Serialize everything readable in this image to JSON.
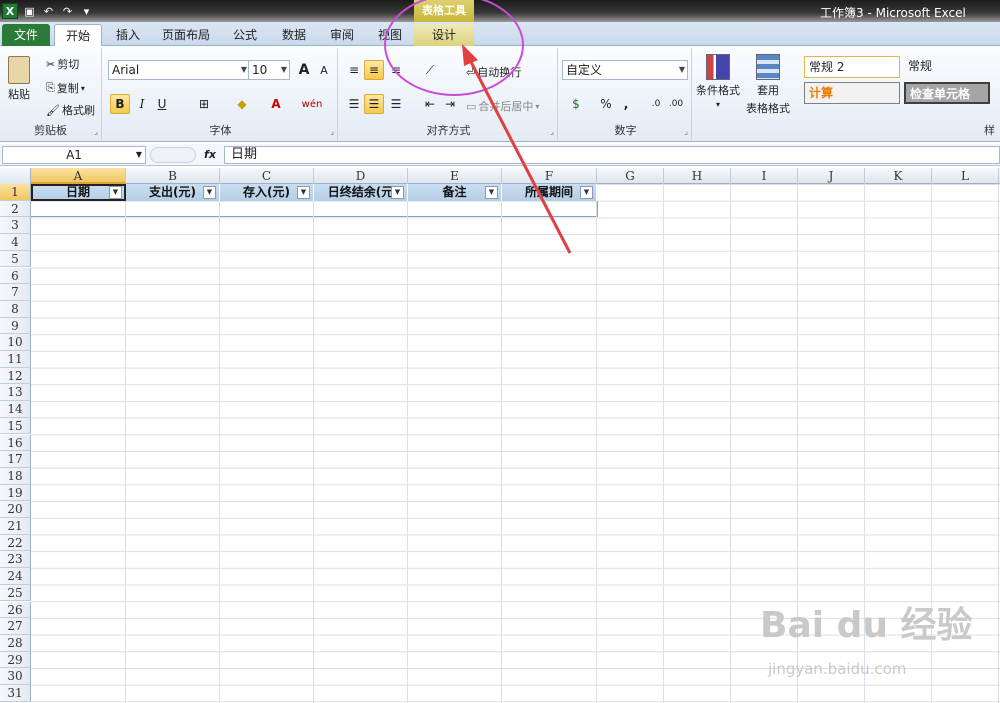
{
  "window": {
    "title": "工作簿3 - Microsoft Excel",
    "context_label": "表格工具"
  },
  "qat": {
    "logo": "X",
    "icons": [
      "save-icon",
      "undo-icon",
      "redo-icon",
      "customize-icon"
    ]
  },
  "tabs": [
    "文件",
    "开始",
    "插入",
    "页面布局",
    "公式",
    "数据",
    "审阅",
    "视图",
    "设计"
  ],
  "ribbon": {
    "clipboard": {
      "paste": "粘贴",
      "cut": "剪切",
      "copy": "复制",
      "format_painter": "格式刷",
      "label": "剪贴板"
    },
    "font": {
      "name": "Arial",
      "size": "10",
      "grow": "A",
      "shrink": "A",
      "bold": "B",
      "italic": "I",
      "underline": "U",
      "phonetic": "wén",
      "label": "字体"
    },
    "align": {
      "wrap": "自动换行",
      "merge": "合并后居中",
      "label": "对齐方式"
    },
    "number": {
      "format": "自定义",
      "percent": "%",
      "comma": ",",
      "label": "数字"
    },
    "styles": {
      "conditional": "条件格式",
      "table_format_1": "套用",
      "table_format_2": "表格格式",
      "style_normal2": "常规 2",
      "style_normal": "常规",
      "style_calc": "计算",
      "style_check": "检查单元格",
      "label_partial": "样"
    }
  },
  "formula_bar": {
    "name_box": "A1",
    "fx": "fx",
    "value": "日期"
  },
  "columns": [
    "A",
    "B",
    "C",
    "D",
    "E",
    "F",
    "G",
    "H",
    "I",
    "J",
    "K",
    "L"
  ],
  "rows": [
    "1",
    "2",
    "3",
    "4",
    "5",
    "6",
    "7",
    "8",
    "9",
    "10",
    "11",
    "12",
    "13",
    "14",
    "15",
    "16",
    "17",
    "18",
    "19",
    "20",
    "21",
    "22",
    "23",
    "24",
    "25",
    "26",
    "27",
    "28",
    "29",
    "30",
    "31"
  ],
  "table_headers": [
    "日期",
    "支出(元)",
    "存入(元)",
    "日终结余(元",
    "备注",
    "所属期间"
  ],
  "watermark": {
    "brand": "Bai du 经验",
    "url": "jingyan.baidu.com"
  }
}
